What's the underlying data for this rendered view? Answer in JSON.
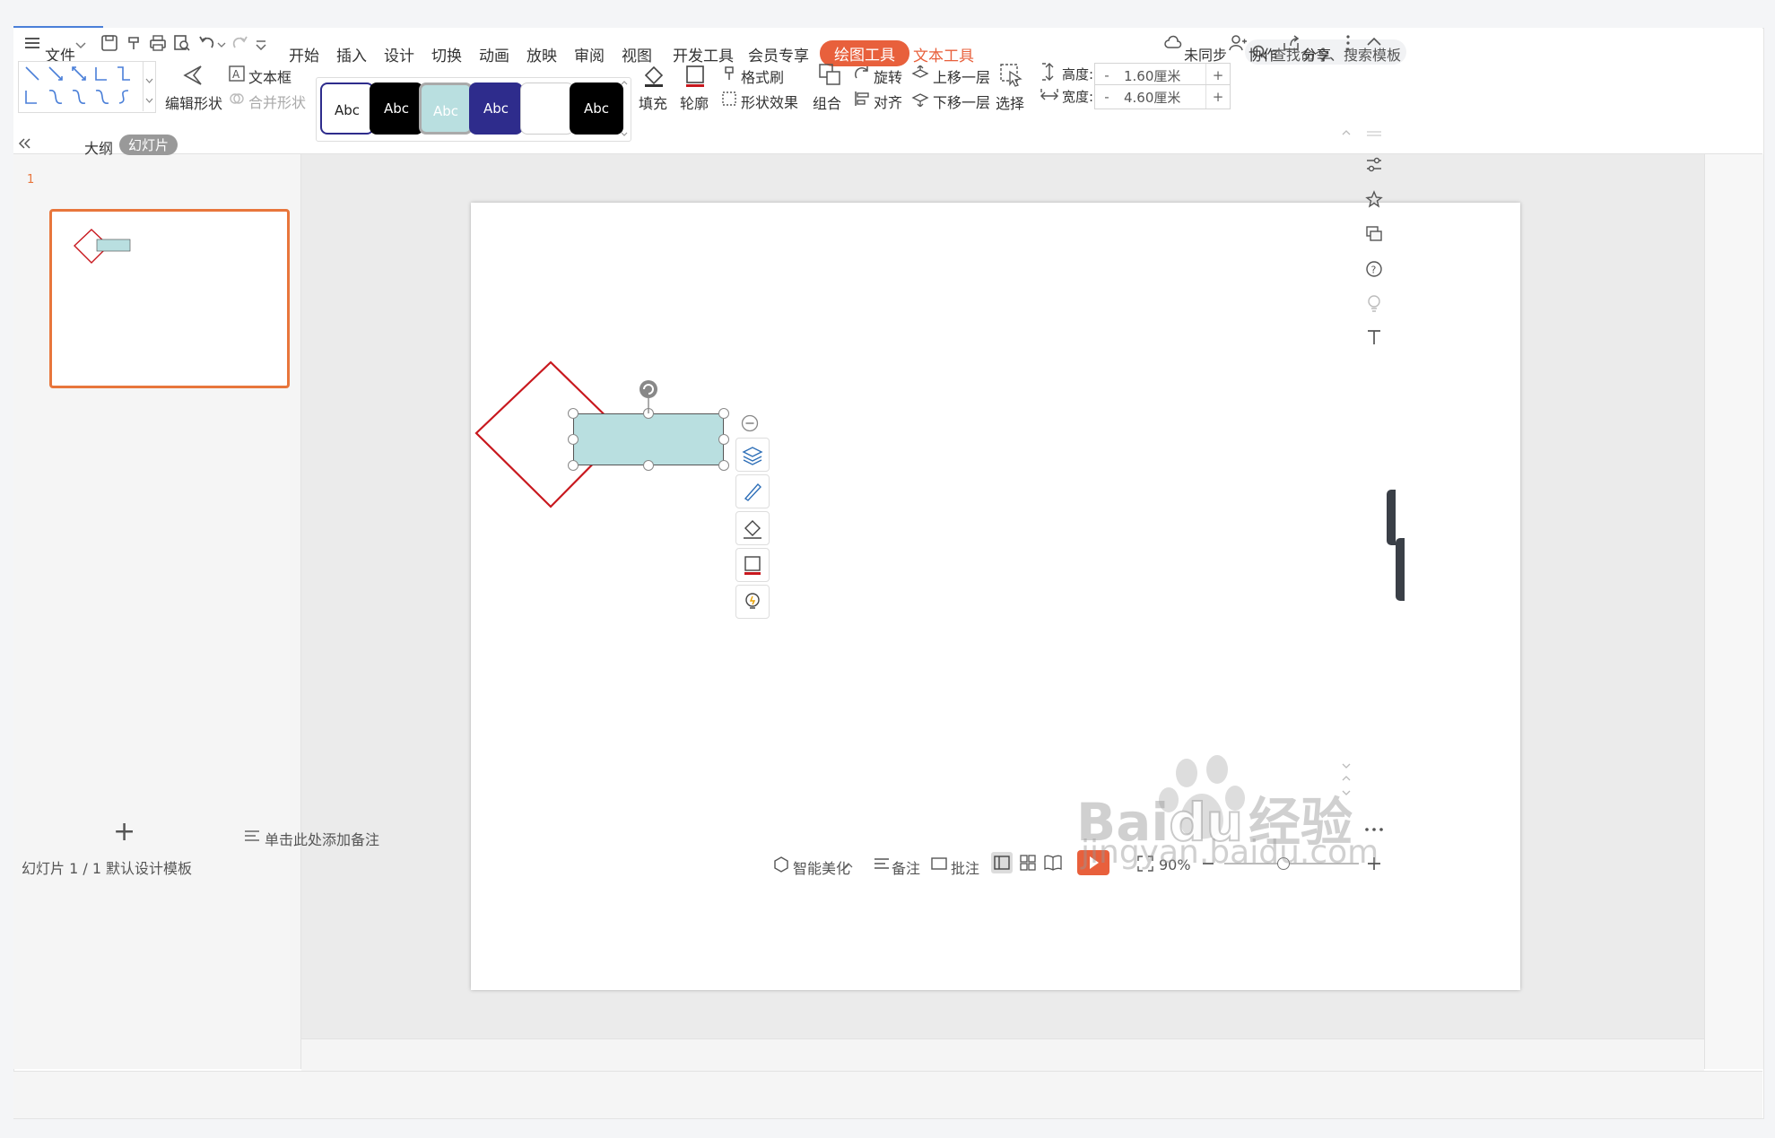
{
  "menu": {
    "file": "文件",
    "tabs": [
      "开始",
      "插入",
      "设计",
      "切换",
      "动画",
      "放映",
      "审阅",
      "视图",
      "开发工具",
      "会员专享"
    ],
    "drawing_tools": "绘图工具",
    "text_tools": "文本工具",
    "search_placeholder": "查找命令、搜索模板",
    "sync": "未同步",
    "collab": "协作",
    "share": "分享"
  },
  "ribbon": {
    "edit_shape": "编辑形状",
    "textbox": "文本框",
    "merge_shape": "合并形状",
    "style_samples": [
      "Abc",
      "Abc",
      "Abc",
      "Abc",
      "",
      "Abc"
    ],
    "fill": "填充",
    "outline": "轮廓",
    "format_painter": "格式刷",
    "shape_effects": "形状效果",
    "group": "组合",
    "rotate": "旋转",
    "align": "对齐",
    "bring_forward": "上移一层",
    "send_backward": "下移一层",
    "select": "选择",
    "height_label": "高度:",
    "height_value": "1.60厘米",
    "width_label": "宽度:",
    "width_value": "4.60厘米",
    "minus": "-",
    "plus": "+"
  },
  "left_panel": {
    "outline_tab": "大纲",
    "slides_tab": "幻灯片",
    "slide_number": "1",
    "add": "+"
  },
  "notes": {
    "placeholder": "单击此处添加备注"
  },
  "status": {
    "slide_info": "幻灯片 1 / 1",
    "template": "默认设计模板",
    "smart_beautify": "智能美化",
    "notes": "备注",
    "comments": "批注",
    "zoom": "90%"
  },
  "colors": {
    "accent": "#e8603c",
    "diamond_stroke": "#c8181e",
    "rect_fill": "#b9dfe0",
    "thumb_border": "#e8763c"
  },
  "watermark": {
    "brand": "Bai",
    "brand_suffix": "du",
    "cn": "经验",
    "url": "jingyan.baidu.com"
  }
}
